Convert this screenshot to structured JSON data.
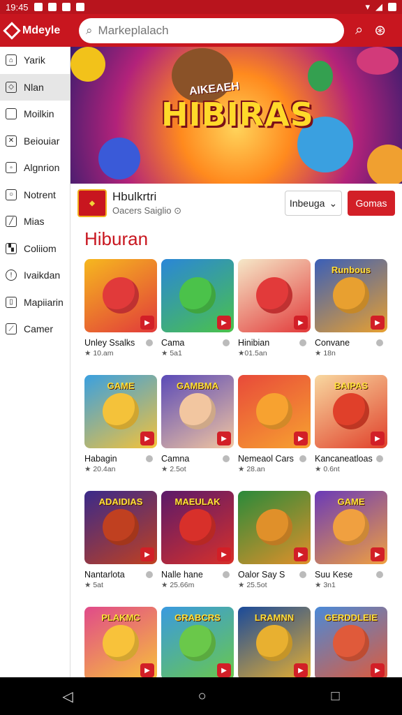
{
  "status_bar": {
    "time": "19:45"
  },
  "appbar": {
    "brand": "Mdeyle",
    "search_placeholder": "Markeplalach"
  },
  "sidebar": {
    "items": [
      {
        "label": "Yarik",
        "icon": "home-icon"
      },
      {
        "label": "Nlan",
        "icon": "tag-icon"
      },
      {
        "label": "Moilkin",
        "icon": "document-icon"
      },
      {
        "label": "Beiouiar",
        "icon": "close-box-icon"
      },
      {
        "label": "Algnrion",
        "icon": "lock-icon"
      },
      {
        "label": "Notrent",
        "icon": "search-icon"
      },
      {
        "label": "Mias",
        "icon": "edit-icon"
      },
      {
        "label": "Coliiom",
        "icon": "image-icon"
      },
      {
        "label": "Ivaikdan",
        "icon": "info-icon"
      },
      {
        "label": "Mapiiarin",
        "icon": "folder-icon"
      },
      {
        "label": "Camer",
        "icon": "chart-icon"
      }
    ],
    "active_index": 1
  },
  "banner": {
    "subtitle": "AIKEAEH",
    "title": "HIBIRAS"
  },
  "developer": {
    "name": "Hbulkrtri",
    "subtitle": "Oacers Saiglio",
    "dropdown_label": "Inbeuga",
    "primary_button": "Gomas"
  },
  "section_title": "Hiburan",
  "games": [
    {
      "name": "Unley Ssalks",
      "meta": "★ 10.am",
      "thumb_label": "",
      "colors": [
        "#f6b81f",
        "#e13a3a"
      ]
    },
    {
      "name": "Cama",
      "meta": "★ 5a1",
      "thumb_label": "",
      "colors": [
        "#2a86d8",
        "#4bc24a"
      ]
    },
    {
      "name": "Hinibian",
      "meta": "★01.5an",
      "thumb_label": "",
      "colors": [
        "#f5e8c8",
        "#e23a3a"
      ]
    },
    {
      "name": "Convane",
      "meta": "★ 18n",
      "thumb_label": "Runbous",
      "colors": [
        "#3a5fb8",
        "#e8a030"
      ]
    },
    {
      "name": "Habagin",
      "meta": "★ 20.4an",
      "thumb_label": "GAME",
      "colors": [
        "#3aa0e0",
        "#f4c23a"
      ]
    },
    {
      "name": "Camna",
      "meta": "★ 2.5ot",
      "thumb_label": "GAMBMA",
      "colors": [
        "#5a4ab8",
        "#f2c6a0"
      ]
    },
    {
      "name": "Nemeaol Cars",
      "meta": "★ 28.an",
      "thumb_label": "",
      "colors": [
        "#e84a3a",
        "#f7a230"
      ]
    },
    {
      "name": "Kancaneatloas",
      "meta": "★ 0.6nt",
      "thumb_label": "BAIPAS",
      "colors": [
        "#f8d8a0",
        "#e0402a"
      ]
    },
    {
      "name": "Nantarlota",
      "meta": "★ 5at",
      "thumb_label": "ADAIDIAS",
      "colors": [
        "#3a2a8a",
        "#c04020"
      ]
    },
    {
      "name": "Nalle hane",
      "meta": "★ 25.66m",
      "thumb_label": "MAEULAK",
      "colors": [
        "#5a1a6a",
        "#d8302a"
      ]
    },
    {
      "name": "Oalor Say S",
      "meta": "★ 25.5ot",
      "thumb_label": "",
      "colors": [
        "#2a8a3a",
        "#e0902a"
      ]
    },
    {
      "name": "Suu Kese",
      "meta": "★ 3n1",
      "thumb_label": "GAME",
      "colors": [
        "#6a3ab8",
        "#f0a040"
      ]
    },
    {
      "name": "",
      "meta": "",
      "thumb_label": "PLAKMC",
      "colors": [
        "#e04a8a",
        "#f8c23a"
      ]
    },
    {
      "name": "",
      "meta": "",
      "thumb_label": "GRABCRS",
      "colors": [
        "#3a9ae0",
        "#6ac84a"
      ]
    },
    {
      "name": "",
      "meta": "",
      "thumb_label": "LRAMNN",
      "colors": [
        "#1a4a9a",
        "#e8b030"
      ]
    },
    {
      "name": "",
      "meta": "",
      "thumb_label": "GERDDLEIE",
      "colors": [
        "#4a8ad8",
        "#e05a3a"
      ]
    }
  ],
  "nav": {
    "back": "◁",
    "home": "○",
    "recents": "□"
  }
}
